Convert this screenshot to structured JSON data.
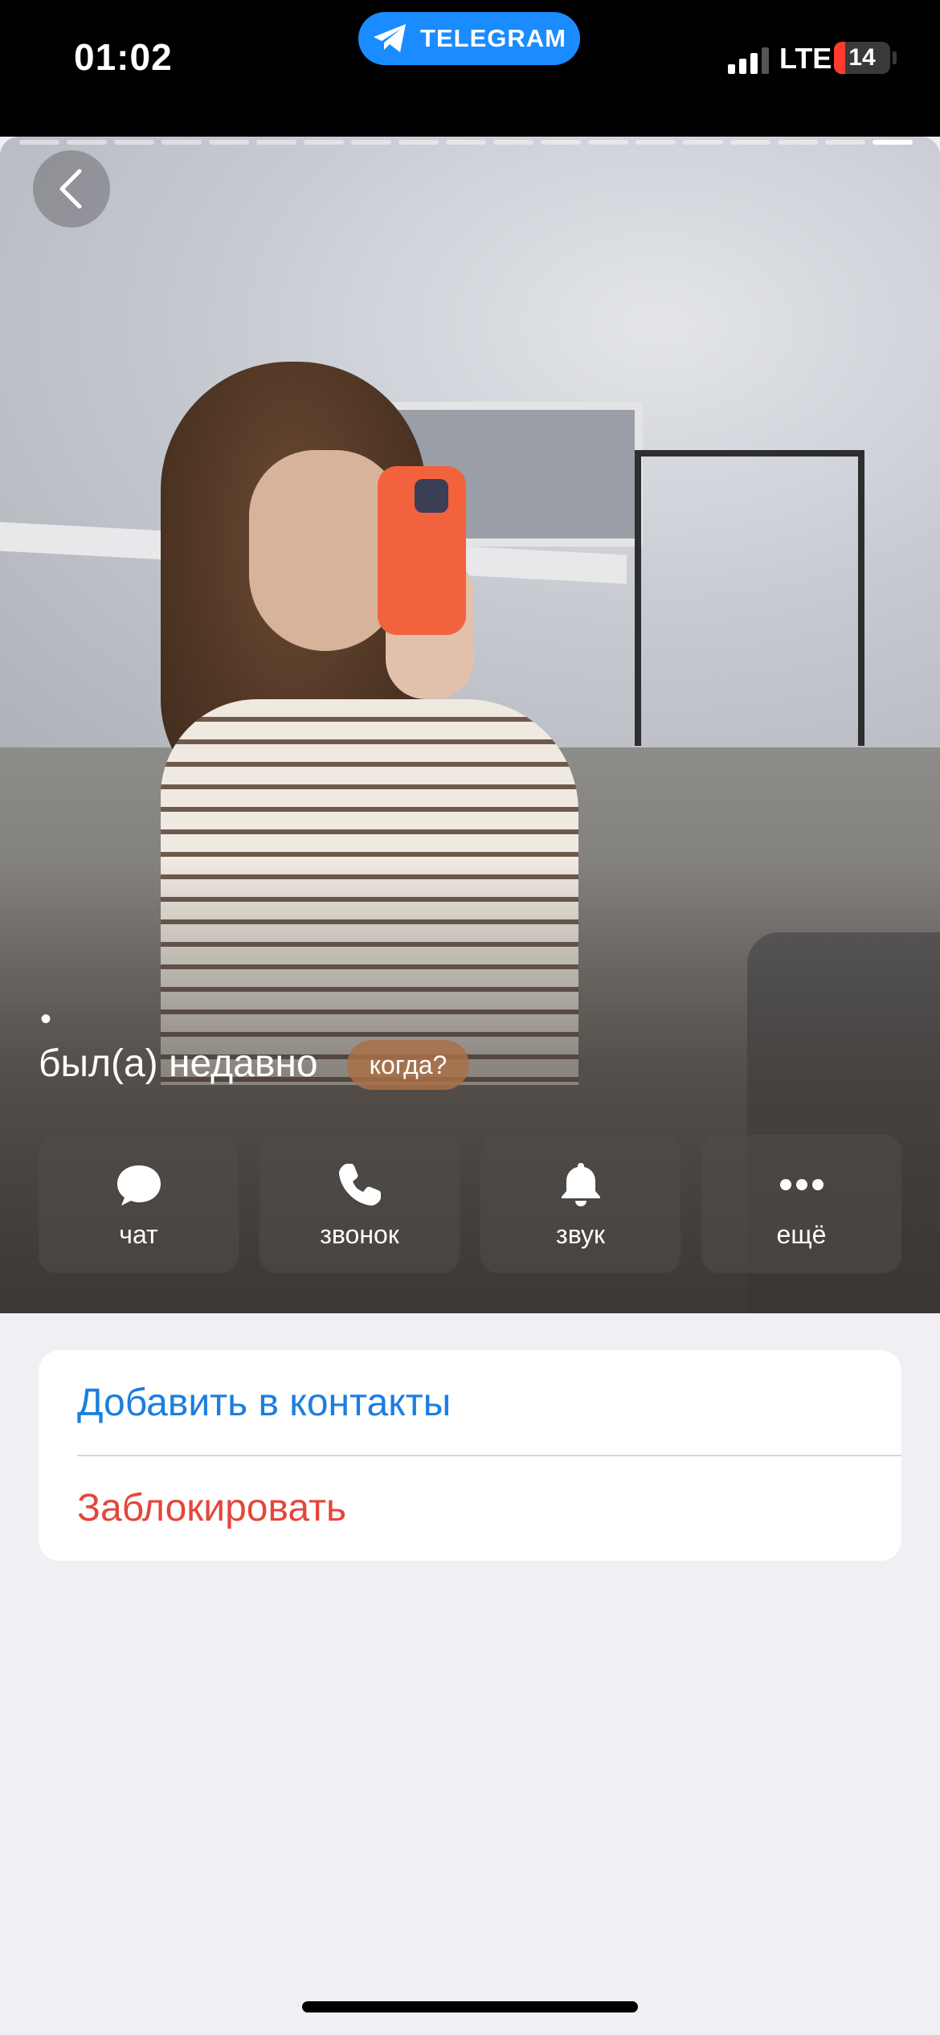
{
  "status_bar": {
    "time": "01:02",
    "app_pill_label": "TELEGRAM",
    "network": "LTE",
    "battery_level": "14",
    "battery_color": "#ff3b30"
  },
  "profile": {
    "back_icon": "chevron-left-icon",
    "photo_count": 19,
    "active_photo_index": 19,
    "name_dot": "•",
    "last_seen": "был(а) недавно",
    "when_button": "когда?"
  },
  "actions": [
    {
      "id": "chat",
      "label": "чат",
      "icon": "chat-bubble-icon"
    },
    {
      "id": "call",
      "label": "звонок",
      "icon": "phone-icon"
    },
    {
      "id": "sound",
      "label": "звук",
      "icon": "bell-icon"
    },
    {
      "id": "more",
      "label": "ещё",
      "icon": "more-dots-icon"
    }
  ],
  "options": {
    "add_contact": "Добавить в контакты",
    "block": "Заблокировать"
  },
  "colors": {
    "accent_blue": "#1b7ee0",
    "destructive_red": "#e4463b",
    "telegram_blue": "#1a8cff"
  }
}
